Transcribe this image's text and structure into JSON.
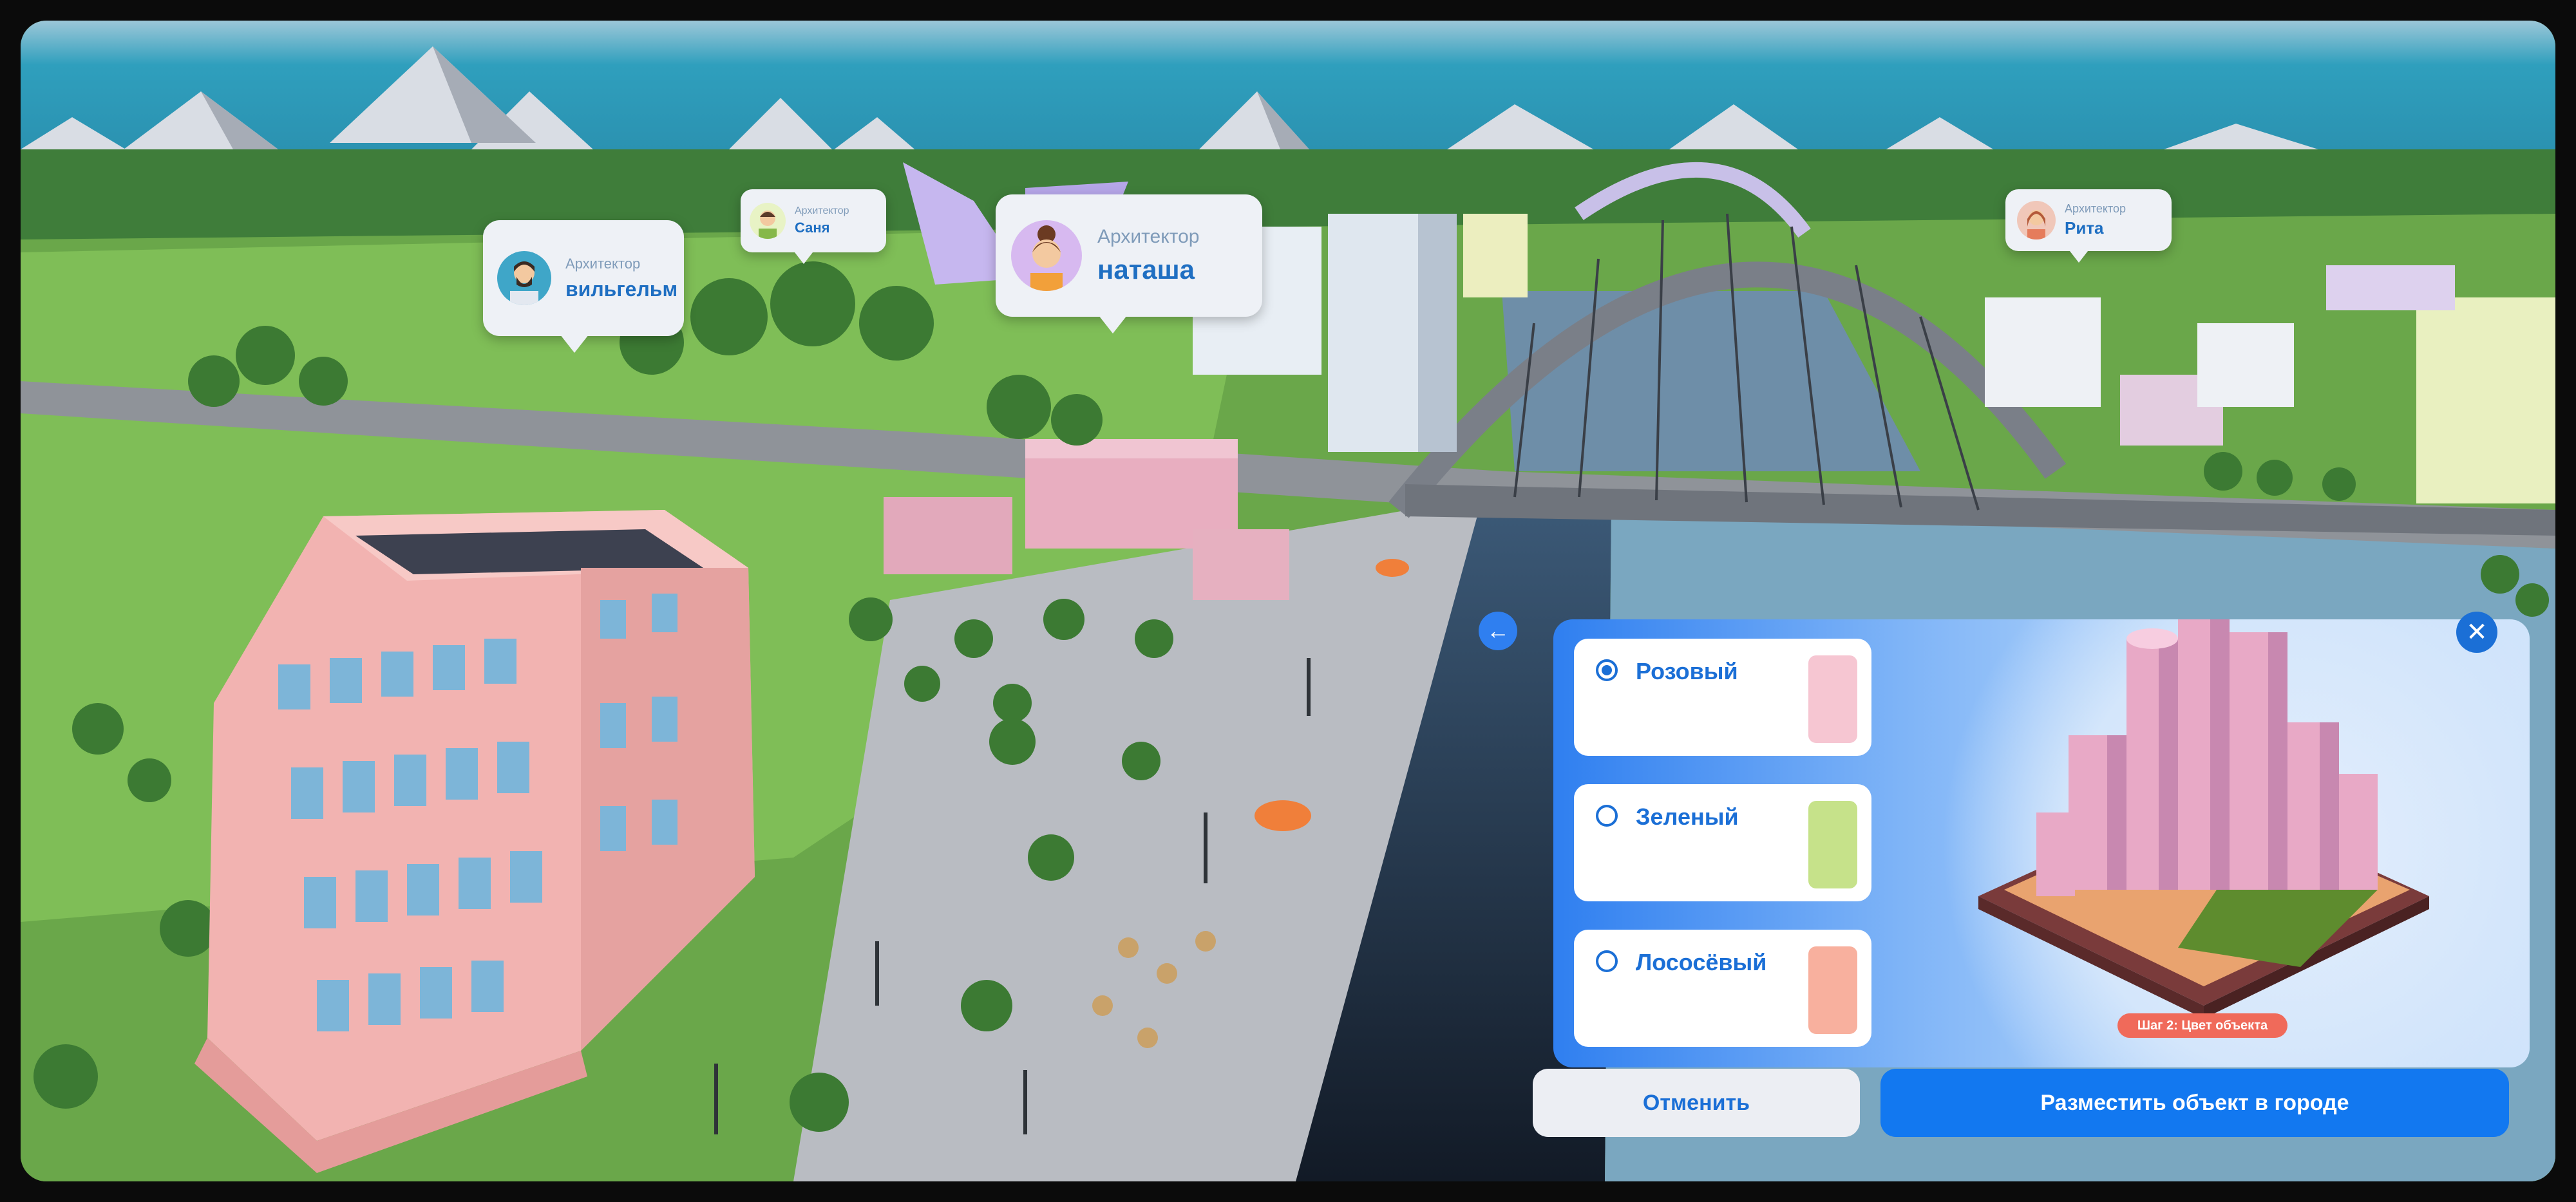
{
  "scene": {
    "labels": [
      {
        "role": "Архитектор",
        "name": "вильгельм"
      },
      {
        "role": "Архитектор",
        "name": "Саня"
      },
      {
        "role": "Архитектор",
        "name": "наташа"
      },
      {
        "role": "Архитектор",
        "name": "Рита"
      }
    ]
  },
  "panel": {
    "options": [
      {
        "label": "Розовый",
        "selected": true,
        "color": "#f6c6d2"
      },
      {
        "label": "Зеленый",
        "selected": false,
        "color": "#c6e28a"
      },
      {
        "label": "Лососёвый",
        "selected": false,
        "color": "#f8b09e"
      }
    ],
    "step_badge": "Шаг 2: Цвет объекта",
    "back_icon": "arrow-left-icon",
    "close_icon": "close-icon"
  },
  "actions": {
    "cancel": "Отменить",
    "place": "Разместить объект в городе"
  },
  "colors": {
    "accent": "#1278f0",
    "badge": "#f06a5a"
  }
}
